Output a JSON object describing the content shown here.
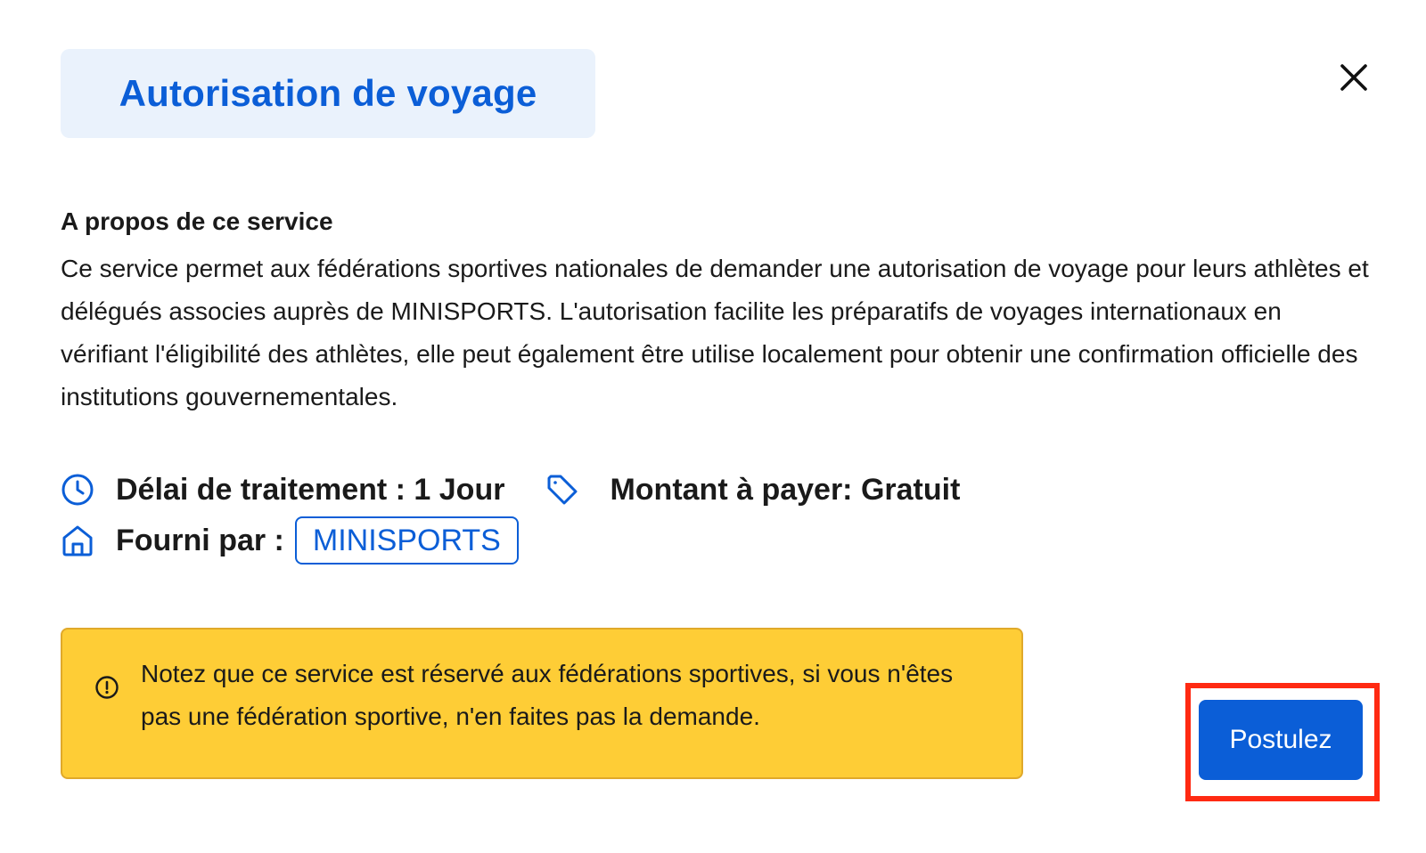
{
  "modal": {
    "title": "Autorisation de voyage",
    "close_icon": "close-icon"
  },
  "about": {
    "heading": "A propos de ce service",
    "text": "Ce service permet aux fédérations sportives nationales de demander une autorisation de voyage pour leurs athlètes et délégués associes auprès de MINISPORTS. L'autorisation facilite les préparatifs de voyages internationaux en vérifiant l'éligibilité des athlètes, elle peut également être utilise localement pour obtenir une confirmation officielle des institutions gouvernementales."
  },
  "details": {
    "processing_time": "Délai de traitement : 1 Jour",
    "amount": "Montant à payer: Gratuit",
    "provided_by_label": "Fourni par :",
    "provider": "MINISPORTS",
    "icons": {
      "processing": "clock-icon",
      "amount": "tag-icon",
      "provider": "home-icon"
    }
  },
  "notice": {
    "icon": "info-circle-icon",
    "text": "Notez que ce service est réservé aux fédérations sportives, si vous n'êtes pas une fédération sportive, n'en faites pas la demande."
  },
  "actions": {
    "apply_label": "Postulez"
  },
  "colors": {
    "accent": "#0b5ed7",
    "title_bg": "#eaf2fc",
    "notice_bg": "#fecd36",
    "highlight": "#ff2a12"
  }
}
